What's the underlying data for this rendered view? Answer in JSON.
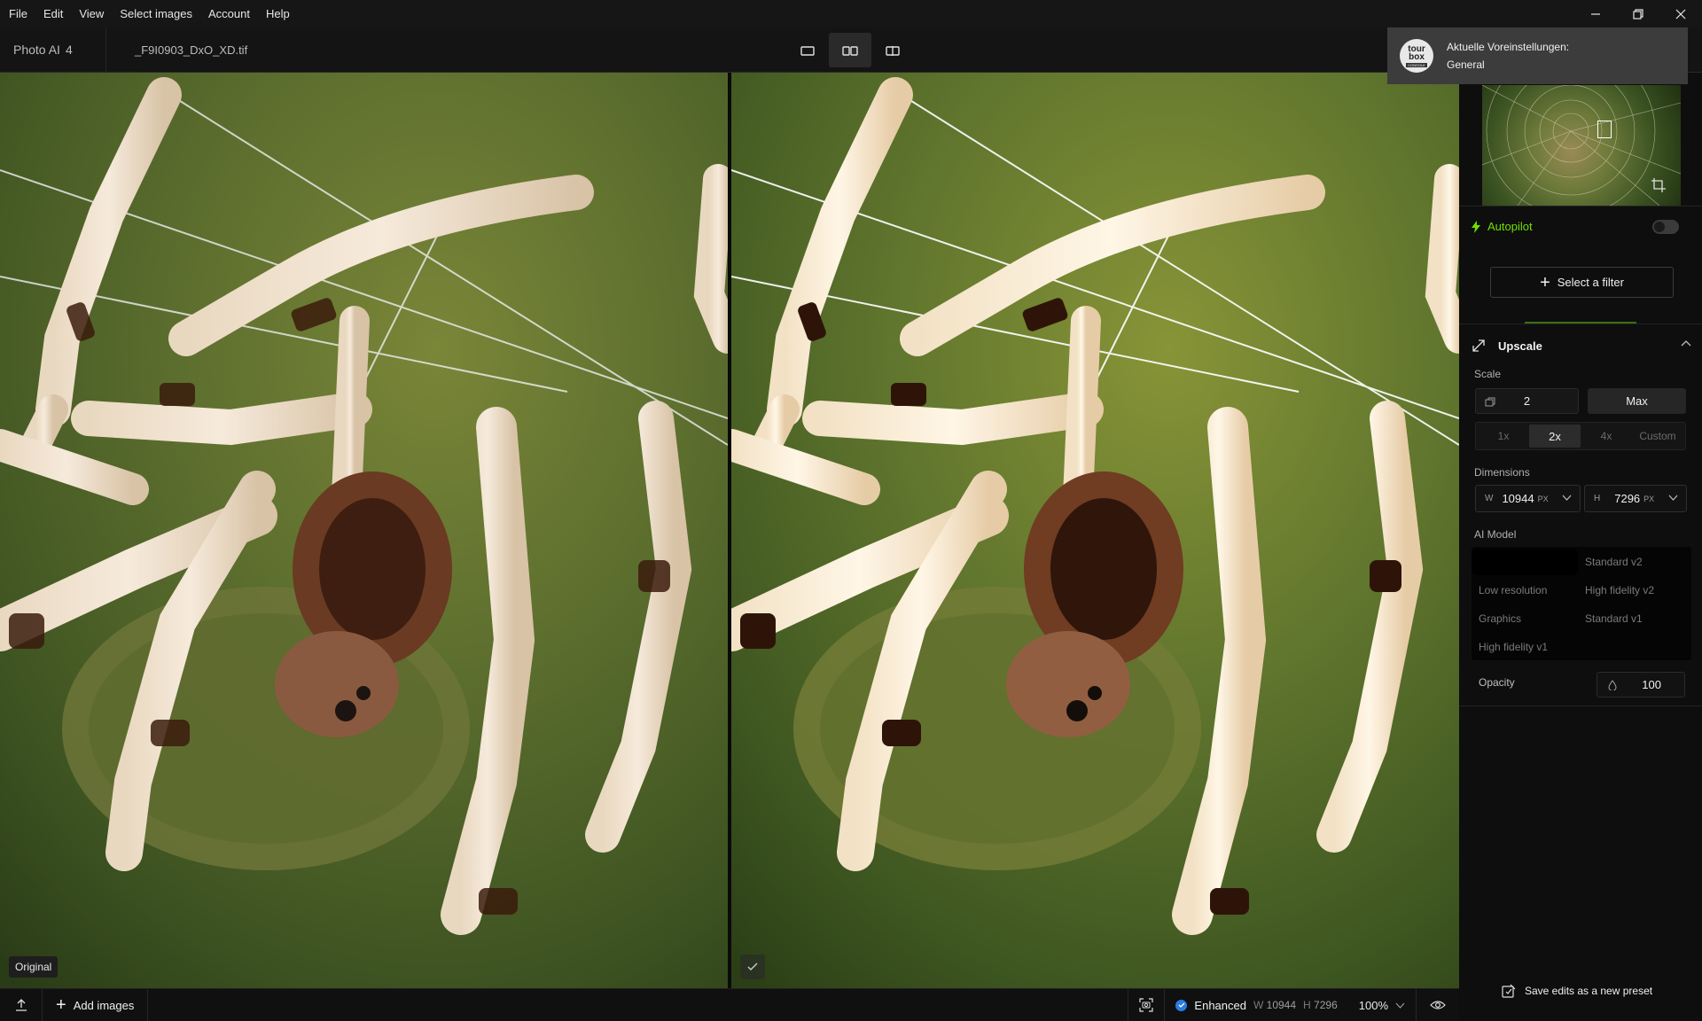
{
  "menu": [
    "File",
    "Edit",
    "View",
    "Select images",
    "Account",
    "Help"
  ],
  "toolbar": {
    "app_name": "Photo AI",
    "app_version": "4",
    "file_name": "_F9I0903_DxO_XD.tif"
  },
  "toast": {
    "logo_text": "tour box",
    "logo_sub": "CONSOLE",
    "line1": "Aktuelle Voreinstellungen:",
    "line2": "General"
  },
  "panes": {
    "left_label": "Original"
  },
  "sidebar": {
    "autopilot_label": "Autopilot",
    "autopilot_on": false,
    "select_filter_label": "Select a filter",
    "upscale": {
      "title": "Upscale",
      "scale_label": "Scale",
      "scale_value": "2",
      "max_label": "Max",
      "scale_options": [
        "1x",
        "2x",
        "4x",
        "Custom"
      ],
      "scale_selected": "2x",
      "dimensions_label": "Dimensions",
      "width_axis": "W",
      "width_value": "10944",
      "height_axis": "H",
      "height_value": "7296",
      "unit": "PX",
      "ai_model_label": "AI Model",
      "models": [
        "Standard v2",
        "Low resolution",
        "High fidelity v2",
        "Graphics",
        "Standard v1",
        "High fidelity v1"
      ],
      "opacity_label": "Opacity",
      "opacity_value": "100"
    },
    "save_preset_label": "Save edits as a new preset"
  },
  "bottombar": {
    "add_images_label": "Add images",
    "enhanced_label": "Enhanced",
    "w_axis": "W",
    "w_value": "10944",
    "h_axis": "H",
    "h_value": "7296",
    "zoom": "100%"
  },
  "colors": {
    "accent_green": "#6fe000",
    "enhanced_blue": "#2a7de1"
  }
}
